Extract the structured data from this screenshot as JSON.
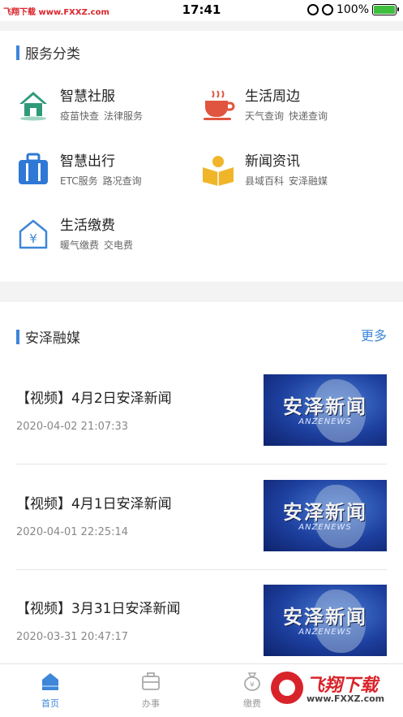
{
  "status_bar": {
    "watermark": "飞翔下载 www.FXXZ.com",
    "time": "17:41",
    "battery": "100%"
  },
  "services_section": {
    "title": "服务分类",
    "items": [
      {
        "name": "智慧社服",
        "subs": [
          "疫苗快查",
          "法律服务"
        ],
        "icon": "house-icon",
        "color": "#2f9a7a"
      },
      {
        "name": "生活周边",
        "subs": [
          "天气查询",
          "快递查询"
        ],
        "icon": "coffee-cup-icon",
        "color": "#e0553f"
      },
      {
        "name": "智慧出行",
        "subs": [
          "ETC服务",
          "路况查询"
        ],
        "icon": "suitcase-icon",
        "color": "#2f78d6"
      },
      {
        "name": "新闻资讯",
        "subs": [
          "县域百科",
          "安泽融媒"
        ],
        "icon": "reader-book-icon",
        "color": "#f1b52a"
      },
      {
        "name": "生活缴费",
        "subs": [
          "暖气缴费",
          "交电费"
        ],
        "icon": "yuan-house-icon",
        "color": "#3d86d8"
      }
    ]
  },
  "news_section": {
    "title": "安泽融媒",
    "more_label": "更多",
    "items": [
      {
        "title": "【视频】4月2日安泽新闻",
        "date": "2020-04-02 21:07:33",
        "thumb_title": "安泽新闻",
        "thumb_sub": "ANZENEWS"
      },
      {
        "title": "【视频】4月1日安泽新闻",
        "date": "2020-04-01 22:25:14",
        "thumb_title": "安泽新闻",
        "thumb_sub": "ANZENEWS"
      },
      {
        "title": "【视频】3月31日安泽新闻",
        "date": "2020-03-31 20:47:17",
        "thumb_title": "安泽新闻",
        "thumb_sub": "ANZENEWS"
      }
    ]
  },
  "tab_bar": {
    "tabs": [
      {
        "label": "首页",
        "icon": "home-icon",
        "active": true
      },
      {
        "label": "办事",
        "icon": "briefcase-icon",
        "active": false
      },
      {
        "label": "缴费",
        "icon": "money-bag-icon",
        "active": false
      }
    ]
  },
  "watermark_badge": {
    "main": "飞翔下载",
    "sub": "www.FXXZ.com"
  },
  "colors": {
    "accent": "#3d86d8",
    "separator": "#f3f3f3"
  }
}
